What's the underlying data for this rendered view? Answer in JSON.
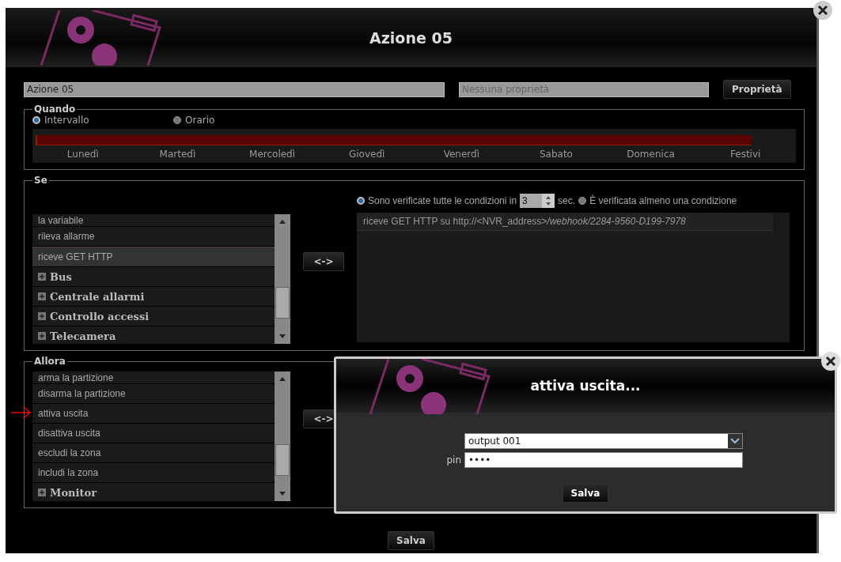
{
  "dialog": {
    "title": "Azione 05",
    "name_field": {
      "value": "Azione 05"
    },
    "properties_field": {
      "placeholder": "Nessuna proprietà"
    },
    "properties_button": "Proprietà",
    "quando": {
      "legend": "Quando",
      "modes": [
        {
          "label": "Intervallo",
          "selected": true
        },
        {
          "label": "Orario",
          "selected": false
        }
      ],
      "days": [
        "Lunedì",
        "Martedì",
        "Mercoledì",
        "Giovedì",
        "Venerdì",
        "Sabato",
        "Domenica",
        "Festivi"
      ]
    },
    "se": {
      "legend": "Se",
      "items": [
        {
          "kind": "leaf",
          "label": "la variabile",
          "selected": false
        },
        {
          "kind": "leaf",
          "label": "rileva allarme",
          "selected": false
        },
        {
          "kind": "leaf",
          "label": "riceve GET HTTP",
          "selected": true
        },
        {
          "kind": "group",
          "label": "Bus",
          "selected": false
        },
        {
          "kind": "group",
          "label": "Centrale allarmi",
          "selected": false
        },
        {
          "kind": "group",
          "label": "Controllo accessi",
          "selected": false
        },
        {
          "kind": "group",
          "label": "Telecamera",
          "selected": false
        }
      ],
      "swap_button": "<->",
      "options": [
        {
          "kind": "all",
          "label": "Sono verificate tutte le condizioni in",
          "selected": true,
          "seconds": "3",
          "unit": "sec."
        },
        {
          "kind": "any",
          "label": "È verificata almeno una condizione",
          "selected": false
        }
      ],
      "conditions": [
        "riceve GET HTTP su http://<NVR_address>*/webhook/2284-9560-D199-7978*"
      ]
    },
    "allora": {
      "legend": "Allora",
      "items": [
        {
          "kind": "leaf",
          "label": "arma la partizione",
          "selected": false
        },
        {
          "kind": "leaf",
          "label": "disarma la partizione",
          "selected": false
        },
        {
          "kind": "leaf",
          "label": "attiva uscita",
          "selected": false
        },
        {
          "kind": "leaf",
          "label": "disattiva uscita",
          "selected": false
        },
        {
          "kind": "leaf",
          "label": "escludi la zona",
          "selected": false
        },
        {
          "kind": "leaf",
          "label": "includi la zona",
          "selected": false
        },
        {
          "kind": "group",
          "label": "Monitor",
          "selected": false
        }
      ],
      "swap_button": "<->"
    },
    "save_button": "Salva"
  },
  "modal": {
    "title": "attiva uscita...",
    "output_select": {
      "value": "output 001"
    },
    "pin": {
      "label": "pin",
      "value": "••••"
    },
    "save_button": "Salva"
  }
}
